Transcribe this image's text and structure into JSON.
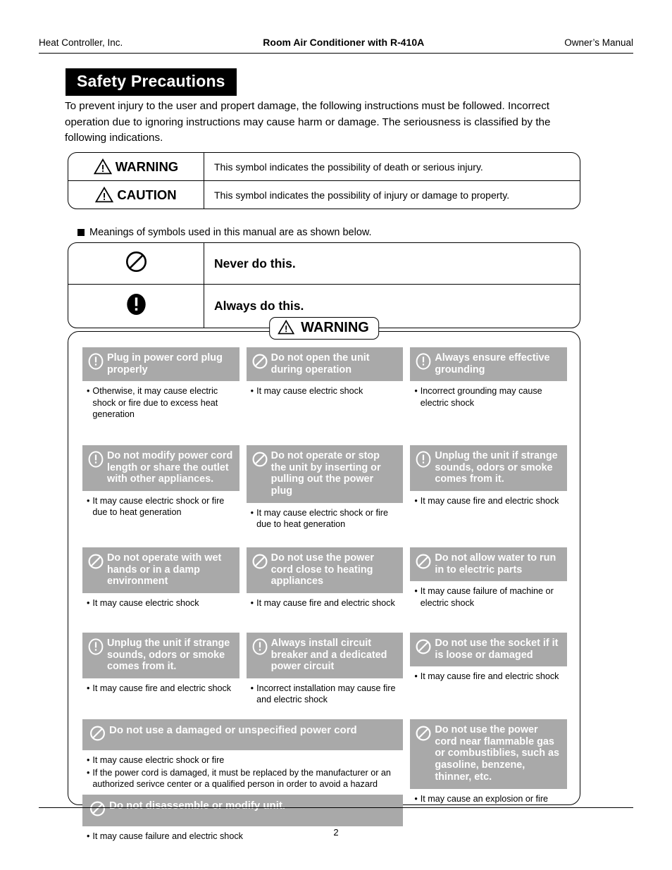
{
  "header": {
    "left": "Heat Controller, Inc.",
    "center": "Room Air Conditioner with R-410A",
    "right": "Owner’s Manual"
  },
  "section_title": "Safety Precautions",
  "intro": "To prevent injury to the user and propert damage, the following instructions must be followed. Incorrect operation due to ignoring instructions may cause harm or damage. The seriousness is classified by the following indications.",
  "signal_table": {
    "rows": [
      {
        "icon": "warning-triangle-icon",
        "word": "WARNING",
        "desc": "This symbol indicates the possibility of death or serious injury."
      },
      {
        "icon": "caution-triangle-icon",
        "word": "CAUTION",
        "desc": "This symbol indicates the possibility of injury or damage to property."
      }
    ]
  },
  "legend_note": "Meanings of symbols used in this manual are as shown below.",
  "legend_table": {
    "rows": [
      {
        "icon": "prohibition-icon",
        "label": "Never do this."
      },
      {
        "icon": "mandatory-icon",
        "label": "Always do this."
      }
    ]
  },
  "warning_panel": {
    "badge": "WARNING",
    "colors": {
      "header_gray": "#a9a9a9",
      "header_text": "#ffffff"
    },
    "columns": [
      {
        "cards": [
          {
            "icon": "mandatory-icon",
            "title": "Plug in power cord plug properly",
            "bullets": [
              "Otherwise, it may cause electric shock or fire due to excess heat generation"
            ]
          },
          {
            "icon": "mandatory-icon",
            "title": "Do not modify power cord length or share the outlet with other appliances.",
            "bullets": [
              "It may cause electric shock or fire due to heat generation"
            ]
          },
          {
            "icon": "prohibition-icon",
            "title": "Do not operate with wet hands or in a damp environment",
            "bullets": [
              "It may cause electric shock"
            ]
          },
          {
            "icon": "mandatory-icon",
            "title": "Unplug the unit if strange sounds, odors or smoke comes from it.",
            "bullets": [
              "It may cause fire and electric shock"
            ]
          }
        ]
      },
      {
        "cards": [
          {
            "icon": "prohibition-icon",
            "title": "Do not open the unit during operation",
            "bullets": [
              "It may cause electric shock"
            ]
          },
          {
            "icon": "prohibition-icon",
            "title": "Do not operate or stop the unit by inserting or pulling out the power plug",
            "bullets": [
              "It may cause electric shock or fire due to heat generation"
            ]
          },
          {
            "icon": "prohibition-icon",
            "title": "Do not use the power cord close to heating appliances",
            "bullets": [
              "It may cause fire and electric shock"
            ]
          },
          {
            "icon": "mandatory-icon",
            "title": "Always install circuit breaker and a dedicated power circuit",
            "bullets": [
              "Incorrect installation may cause fire and electric shock"
            ]
          }
        ]
      },
      {
        "cards": [
          {
            "icon": "mandatory-icon",
            "title": "Always ensure effective grounding",
            "bullets": [
              "Incorrect grounding may cause electric shock"
            ]
          },
          {
            "icon": "mandatory-icon",
            "title": "Unplug the unit if strange sounds, odors or smoke comes from it.",
            "bullets": [
              "It may cause fire and electric shock"
            ]
          },
          {
            "icon": "prohibition-icon",
            "title": "Do not allow water to run in to electric parts",
            "bullets": [
              "It may cause failure of machine or electric shock"
            ]
          },
          {
            "icon": "prohibition-icon",
            "title": "Do not use the socket if it is loose or damaged",
            "bullets": [
              "It may cause fire and electric shock"
            ]
          }
        ]
      }
    ],
    "bottom_left_cards": [
      {
        "icon": "prohibition-icon",
        "title": "Do not use a damaged or unspecified power cord",
        "bullets": [
          "It may cause electric shock or fire",
          "If the power cord is damaged, it must be replaced by the manufacturer or an authorized serivce center or a qualified person in order to avoid a hazard"
        ]
      },
      {
        "icon": "prohibition-icon",
        "title": "Do not disassemble or modify unit.",
        "bullets": [
          "It may cause failure and electric shock"
        ]
      }
    ],
    "bottom_right_card": {
      "icon": "prohibition-icon",
      "title": "Do not use the power cord near flammable gas or combustiblies, such as gasoline, benzene, thinner, etc.",
      "bullets": [
        "It may cause an explosion or fire"
      ]
    },
    "bullet_marker": "•"
  },
  "page_number": "2"
}
